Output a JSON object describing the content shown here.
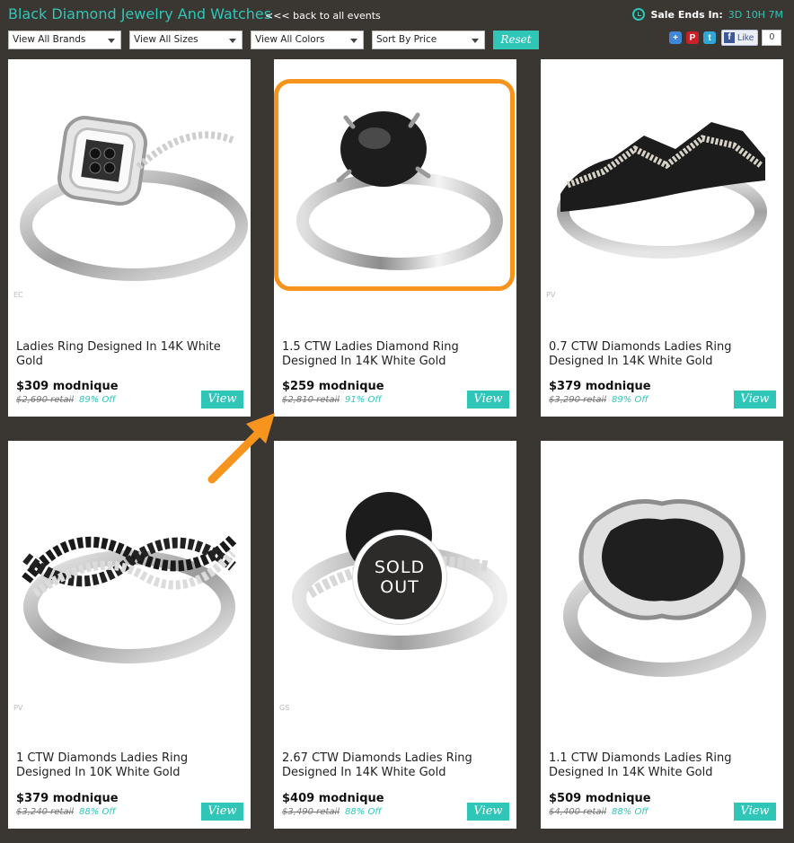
{
  "header": {
    "title": "Black Diamond Jewelry And Watches",
    "back_link": "<<< back to all events",
    "sale_label": "Sale Ends In:",
    "sale_time": "3D 10H 7M"
  },
  "filters": {
    "brands": "View All Brands",
    "sizes": "View All Sizes",
    "colors": "View All Colors",
    "sort": "Sort By Price",
    "reset": "Reset"
  },
  "social": {
    "icons": [
      "share-icon",
      "pinterest-icon",
      "twitter-icon"
    ],
    "fb_like": "Like",
    "fb_count": "0"
  },
  "products": [
    {
      "brand": "EC",
      "name": "Ladies Ring Designed In 14K White Gold",
      "price": "$309 modnique",
      "retail": "$2,690 retail",
      "off": "89% Off",
      "view": "View"
    },
    {
      "brand": "",
      "name": "1.5 CTW Ladies Diamond Ring Designed In 14K White Gold",
      "price": "$259 modnique",
      "retail": "$2,810 retail",
      "off": "91% Off",
      "view": "View"
    },
    {
      "brand": "PV",
      "name": "0.7 CTW Diamonds Ladies Ring Designed In 14K White Gold",
      "price": "$379 modnique",
      "retail": "$3,290 retail",
      "off": "89% Off",
      "view": "View"
    },
    {
      "brand": "PV",
      "name": "1 CTW Diamonds Ladies Ring Designed In 10K White Gold",
      "price": "$379 modnique",
      "retail": "$3,240 retail",
      "off": "88% Off",
      "view": "View"
    },
    {
      "brand": "GS",
      "name": "2.67 CTW Diamonds Ladies Ring Designed In 14K White Gold",
      "price": "$409 modnique",
      "retail": "$3,490 retail",
      "off": "88% Off",
      "view": "View",
      "sold_out": [
        "SOLD",
        "OUT"
      ]
    },
    {
      "brand": "",
      "name": "1.1 CTW Diamonds Ladies Ring Designed In 14K White Gold",
      "price": "$509 modnique",
      "retail": "$4,400 retail",
      "off": "88% Off",
      "view": "View"
    }
  ],
  "colors": {
    "accent": "#2fc6b8",
    "background": "#3a3733",
    "highlight": "#f7941e"
  }
}
